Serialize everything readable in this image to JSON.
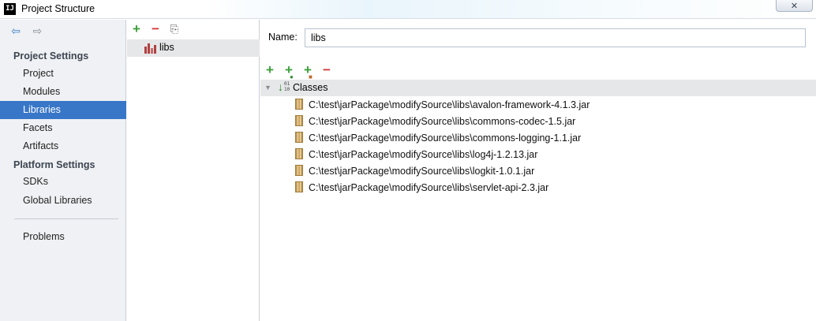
{
  "window": {
    "title": "Project Structure",
    "app_icon": "IJ",
    "close_glyph": "✕"
  },
  "nav": {
    "back_glyph": "⇦",
    "forward_glyph": "⇨",
    "sections": [
      {
        "label": "Project Settings",
        "items": [
          {
            "label": "Project",
            "selected": false
          },
          {
            "label": "Modules",
            "selected": false
          },
          {
            "label": "Libraries",
            "selected": true
          },
          {
            "label": "Facets",
            "selected": false
          },
          {
            "label": "Artifacts",
            "selected": false
          }
        ]
      },
      {
        "label": "Platform Settings",
        "items": [
          {
            "label": "SDKs",
            "selected": false
          },
          {
            "label": "Global Libraries",
            "selected": false
          }
        ]
      }
    ],
    "bottom_items": [
      {
        "label": "Problems"
      }
    ]
  },
  "library_list": {
    "toolbar": {
      "add": "+",
      "remove": "−",
      "copy": "⎘"
    },
    "items": [
      {
        "label": "libs",
        "selected": true
      }
    ]
  },
  "library_detail": {
    "name_label": "Name:",
    "name_value": "libs",
    "toolbar": {
      "add": "+",
      "remove": "−"
    },
    "classes_label": "Classes",
    "classes": [
      "C:\\test\\jarPackage\\modifySource\\libs\\avalon-framework-4.1.3.jar",
      "C:\\test\\jarPackage\\modifySource\\libs\\commons-codec-1.5.jar",
      "C:\\test\\jarPackage\\modifySource\\libs\\commons-logging-1.1.jar",
      "C:\\test\\jarPackage\\modifySource\\libs\\log4j-1.2.13.jar",
      "C:\\test\\jarPackage\\modifySource\\libs\\logkit-1.0.1.jar",
      "C:\\test\\jarPackage\\modifySource\\libs\\servlet-api-2.3.jar"
    ]
  },
  "colors": {
    "selection": "#3876c7",
    "add": "#3ca13c",
    "remove": "#d23a3a",
    "nav_bg": "#eff1f4"
  }
}
